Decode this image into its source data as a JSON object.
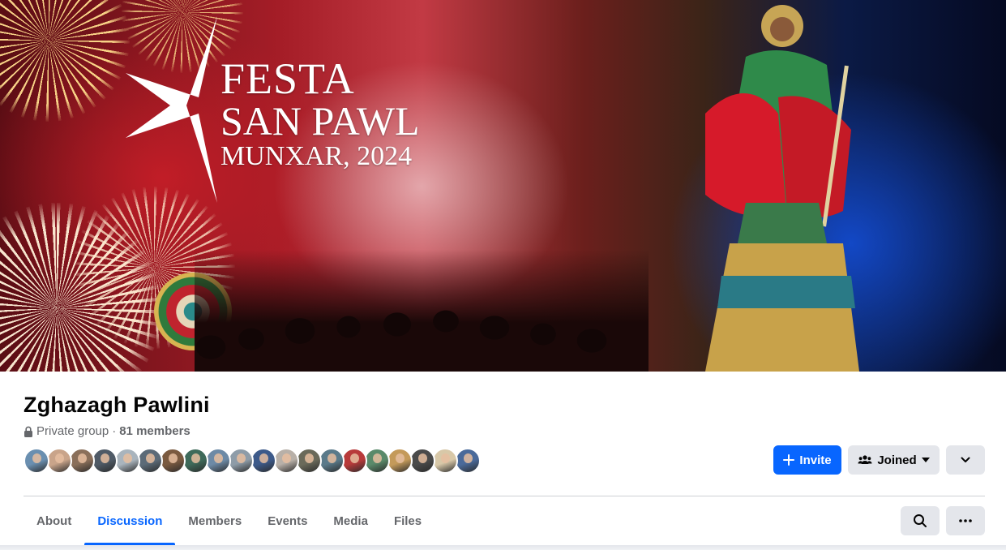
{
  "cover": {
    "title_line1": "FESTA",
    "title_line2": "SAN PAWL",
    "title_line3": "MUNXAR, 2024"
  },
  "group": {
    "name": "Zghazagh Pawlini",
    "privacy": "Private group",
    "separator": "·",
    "members": "81 members"
  },
  "member_avatars": [
    {
      "bg": "#6a8fb0"
    },
    {
      "bg": "#c9a48a"
    },
    {
      "bg": "#8a6f5a"
    },
    {
      "bg": "#4f5a66"
    },
    {
      "bg": "#a9b4bd"
    },
    {
      "bg": "#5c6b78"
    },
    {
      "bg": "#7a5a40"
    },
    {
      "bg": "#3e6a5a"
    },
    {
      "bg": "#6d8aa6"
    },
    {
      "bg": "#8e9ca8"
    },
    {
      "bg": "#3d5a8a"
    },
    {
      "bg": "#b8b0a8"
    },
    {
      "bg": "#6a6a5a"
    },
    {
      "bg": "#5a7a8a"
    },
    {
      "bg": "#b83a3a"
    },
    {
      "bg": "#5a8a6a"
    },
    {
      "bg": "#c49a5a"
    },
    {
      "bg": "#4a4a4a"
    },
    {
      "bg": "#d8c8a8"
    },
    {
      "bg": "#4a6a9a"
    }
  ],
  "actions": {
    "invite_label": "Invite",
    "joined_label": "Joined"
  },
  "tabs": [
    {
      "label": "About",
      "active": false
    },
    {
      "label": "Discussion",
      "active": true
    },
    {
      "label": "Members",
      "active": false
    },
    {
      "label": "Events",
      "active": false
    },
    {
      "label": "Media",
      "active": false
    },
    {
      "label": "Files",
      "active": false
    }
  ],
  "colors": {
    "accent": "#0866ff",
    "button_gray": "#e4e6eb",
    "secondary_text": "#65676b"
  },
  "icons": {
    "privacy": "lock-icon",
    "invite": "plus-icon",
    "joined": "people-icon",
    "joined_caret": "caret-down-icon",
    "more_top": "chevron-down-icon",
    "search": "search-icon",
    "more_tabs": "ellipsis-icon"
  }
}
